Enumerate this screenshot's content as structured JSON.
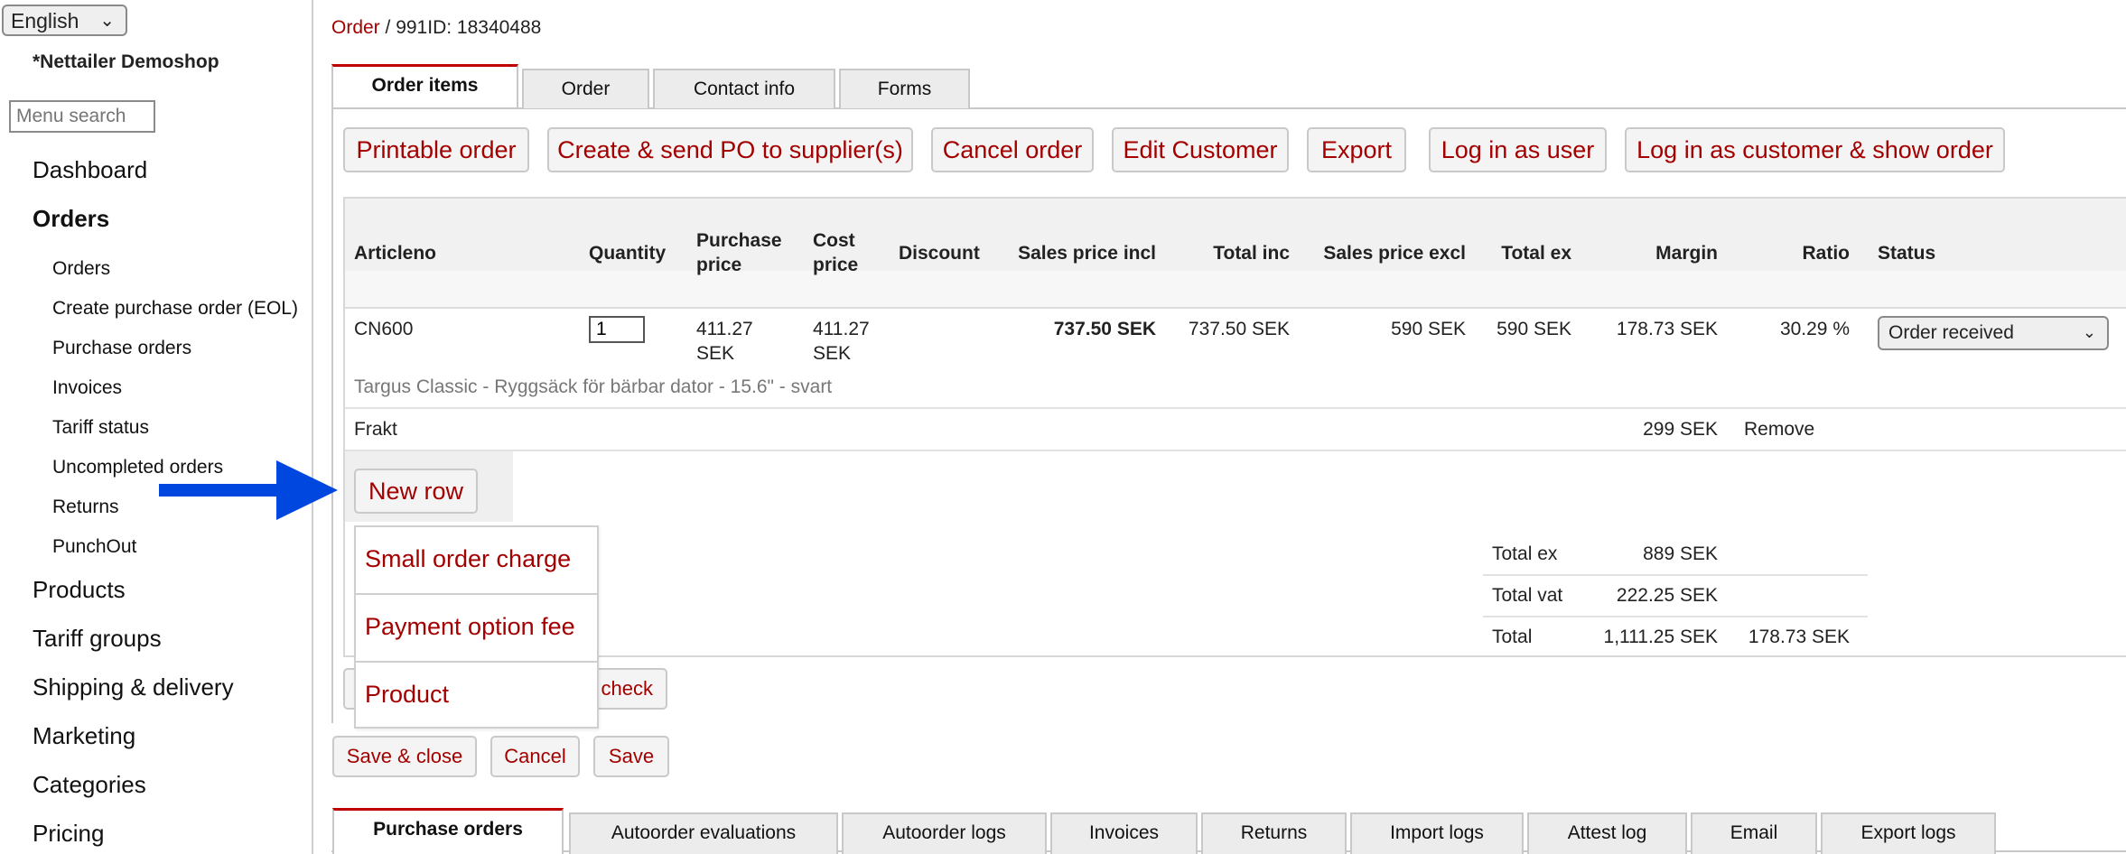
{
  "sidebar": {
    "language": "English",
    "shop_name": "*Nettailer Demoshop",
    "menu_search_placeholder": "Menu search",
    "items": [
      {
        "label": "Dashboard"
      },
      {
        "label": "Orders"
      },
      {
        "label": "Products"
      },
      {
        "label": "Tariff groups"
      },
      {
        "label": "Shipping & delivery"
      },
      {
        "label": "Marketing"
      },
      {
        "label": "Categories"
      },
      {
        "label": "Pricing"
      }
    ],
    "orders_sub": [
      {
        "label": "Orders"
      },
      {
        "label": "Create purchase order (EOL)"
      },
      {
        "label": "Purchase orders"
      },
      {
        "label": "Invoices"
      },
      {
        "label": "Tariff status"
      },
      {
        "label": "Uncompleted orders"
      },
      {
        "label": "Returns"
      },
      {
        "label": "PunchOut"
      }
    ]
  },
  "breadcrumb": {
    "link": "Order",
    "separator": " / ",
    "current": "991ID: 18340488"
  },
  "tabs": [
    {
      "label": "Order items"
    },
    {
      "label": "Order"
    },
    {
      "label": "Contact info"
    },
    {
      "label": "Forms"
    }
  ],
  "actions": [
    {
      "label": "Printable order"
    },
    {
      "label": "Create & send PO to supplier(s)"
    },
    {
      "label": "Cancel order"
    },
    {
      "label": "Edit Customer"
    },
    {
      "label": "Export"
    },
    {
      "label": "Log in as user"
    },
    {
      "label": "Log in as customer & show order"
    }
  ],
  "table": {
    "headers": {
      "articleno": "Articleno",
      "quantity": "Quantity",
      "purchase_price": [
        "Purchase",
        "price"
      ],
      "cost_price": [
        "Cost",
        "price"
      ],
      "discount": "Discount",
      "sales_price_incl": "Sales price incl",
      "total_inc": "Total inc",
      "sales_price_excl": "Sales price excl",
      "total_ex": "Total ex",
      "margin": "Margin",
      "ratio": "Ratio",
      "status": "Status"
    },
    "row": {
      "articleno": "CN600",
      "quantity": "1",
      "purchase_price": [
        "411.27",
        "SEK"
      ],
      "cost_price": [
        "411.27",
        "SEK"
      ],
      "sales_price_incl": "737.50 SEK",
      "total_inc": "737.50 SEK",
      "sales_price_excl": "590 SEK",
      "total_ex": "590 SEK",
      "margin": "178.73 SEK",
      "ratio": "30.29 %",
      "status": "Order received",
      "description": "Targus Classic - Ryggsäck för bärbar dator - 15.6\" - svart"
    },
    "freight": {
      "label": "Frakt",
      "amount": "299 SEK",
      "remove": "Remove"
    },
    "new_row_button": "New row",
    "totals": [
      {
        "label": "Total ex",
        "value": "889 SEK",
        "margin": ""
      },
      {
        "label": "Total vat",
        "value": "222.25 SEK",
        "margin": ""
      },
      {
        "label": "Total",
        "value": "1,111.25 SEK",
        "margin": "178.73 SEK"
      }
    ],
    "partial_button_text": "check"
  },
  "dropdown": {
    "items": [
      {
        "label": "Small order charge"
      },
      {
        "label": "Payment option fee"
      },
      {
        "label": "Product"
      }
    ]
  },
  "bottom_buttons": [
    {
      "label": "Save & close"
    },
    {
      "label": "Cancel"
    },
    {
      "label": "Save"
    }
  ],
  "bottom_tabs": [
    {
      "label": "Purchase orders"
    },
    {
      "label": "Autoorder evaluations"
    },
    {
      "label": "Autoorder logs"
    },
    {
      "label": "Invoices"
    },
    {
      "label": "Returns"
    },
    {
      "label": "Import logs"
    },
    {
      "label": "Attest log"
    },
    {
      "label": "Email"
    },
    {
      "label": "Export logs"
    }
  ],
  "colors": {
    "link": "#a30000",
    "active_tab_border": "#c00000",
    "arrow": "#0047e0"
  }
}
